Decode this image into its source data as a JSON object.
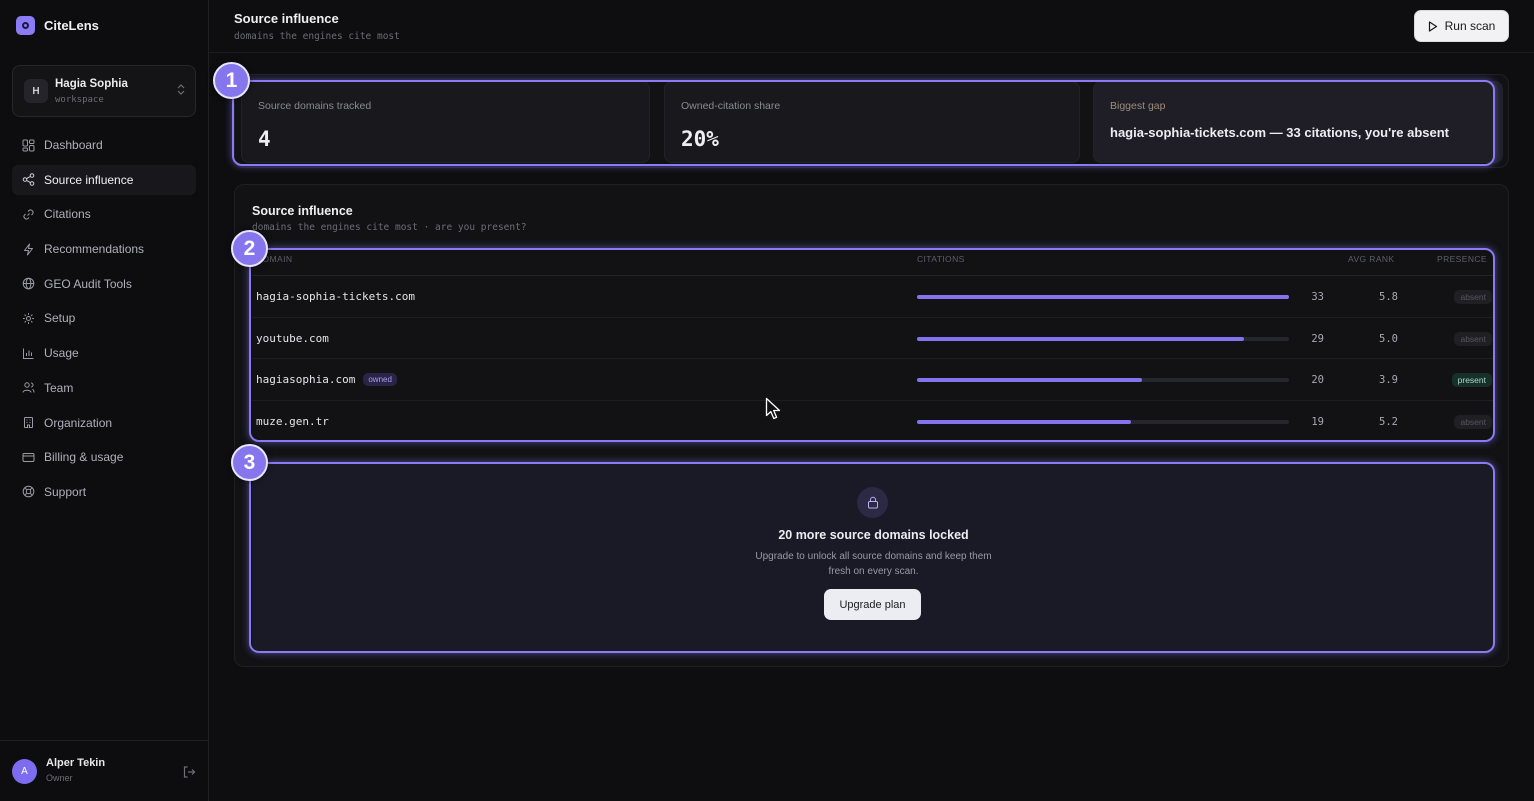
{
  "brand": {
    "name": "CiteLens"
  },
  "workspace": {
    "initial": "H",
    "name": "Hagia Sophia",
    "label": "workspace"
  },
  "nav": [
    {
      "label": "Dashboard",
      "icon": "dashboard-icon"
    },
    {
      "label": "Source influence",
      "icon": "share-icon",
      "active": true
    },
    {
      "label": "Citations",
      "icon": "link-icon"
    },
    {
      "label": "Recommendations",
      "icon": "lightning-icon"
    },
    {
      "label": "GEO Audit Tools",
      "icon": "globe-icon"
    },
    {
      "label": "Setup",
      "icon": "gear-icon"
    },
    {
      "label": "Usage",
      "icon": "bar-chart-icon"
    },
    {
      "label": "Team",
      "icon": "users-icon"
    },
    {
      "label": "Organization",
      "icon": "building-icon"
    },
    {
      "label": "Billing & usage",
      "icon": "credit-card-icon"
    },
    {
      "label": "Support",
      "icon": "lifebuoy-icon"
    }
  ],
  "user": {
    "initial": "A",
    "name": "Alper Tekin",
    "role": "Owner"
  },
  "header": {
    "title": "Source influence",
    "subtitle": "domains the engines cite most",
    "run_scan_label": "Run scan"
  },
  "stats": {
    "tracked_label": "Source domains tracked",
    "tracked_value": "4",
    "share_label": "Owned-citation share",
    "share_value": "20%",
    "gap_label": "Biggest gap",
    "gap_value": "hagia-sophia-tickets.com — 33 citations, you're absent"
  },
  "influence": {
    "title": "Source influence",
    "subtitle": "domains the engines cite most · are you present?",
    "columns": {
      "domain": "DOMAIN",
      "citations": "CITATIONS",
      "avg_rank": "AVG RANK",
      "presence": "PRESENCE"
    },
    "rows": [
      {
        "domain": "hagia-sophia-tickets.com",
        "owned": false,
        "citations": 33,
        "citations_text": "33",
        "avg_rank": "5.8",
        "presence": "absent"
      },
      {
        "domain": "youtube.com",
        "owned": false,
        "citations": 29,
        "citations_text": "29",
        "avg_rank": "5.0",
        "presence": "absent"
      },
      {
        "domain": "hagiasophia.com",
        "owned": true,
        "owned_label": "owned",
        "citations": 20,
        "citations_text": "20",
        "avg_rank": "3.9",
        "presence": "present"
      },
      {
        "domain": "muze.gen.tr",
        "owned": false,
        "citations": 19,
        "citations_text": "19",
        "avg_rank": "5.2",
        "presence": "absent"
      }
    ],
    "max_citations": 33
  },
  "locked": {
    "title": "20 more source domains locked",
    "description": "Upgrade to unlock all source domains and keep them fresh on every scan.",
    "button_label": "Upgrade plan"
  },
  "markers": [
    "1",
    "2",
    "3"
  ],
  "colors": {
    "accent": "#8472ee",
    "background": "#0e0e10",
    "present": "#a9d9c6"
  }
}
